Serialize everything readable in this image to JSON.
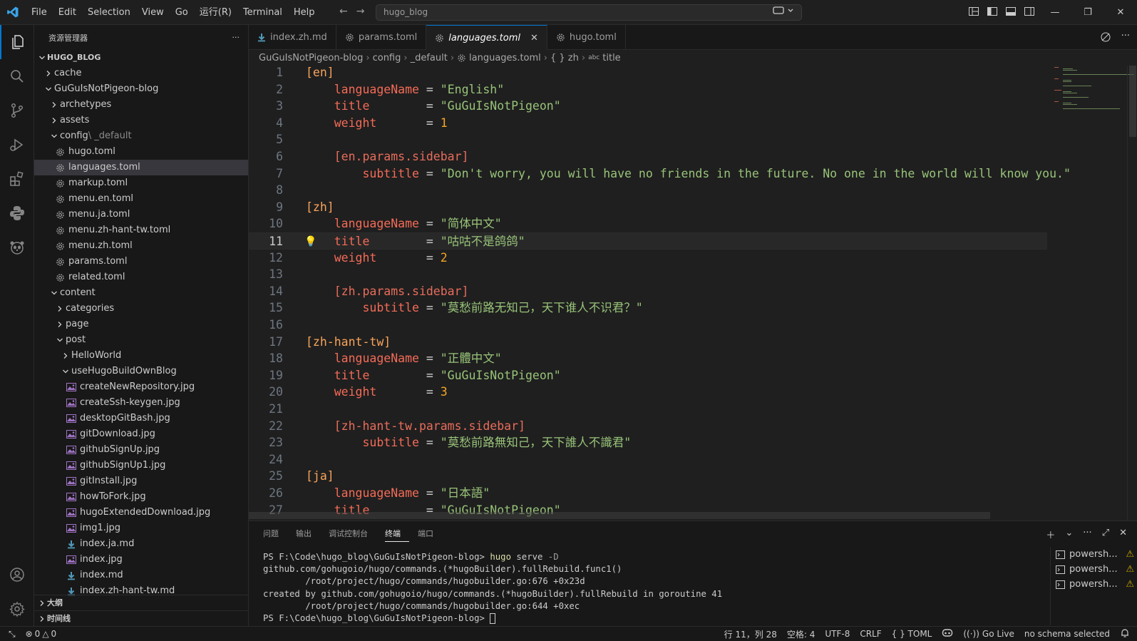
{
  "titlebar": {
    "menus": [
      "File",
      "Edit",
      "Selection",
      "View",
      "Go",
      "运行(R)",
      "Terminal",
      "Help"
    ],
    "search_text": "hugo_blog"
  },
  "explorer": {
    "title": "资源管理器",
    "more": "···",
    "root": "HUGO_BLOG",
    "tree": [
      {
        "label": "cache",
        "depth": 0,
        "kind": "folder",
        "open": false
      },
      {
        "label": "GuGuIsNotPigeon-blog",
        "depth": 0,
        "kind": "folder",
        "open": true
      },
      {
        "label": "archetypes",
        "depth": 1,
        "kind": "folder",
        "open": false
      },
      {
        "label": "assets",
        "depth": 1,
        "kind": "folder",
        "open": false
      },
      {
        "label": "config",
        "sub": "\\ _default",
        "depth": 1,
        "kind": "folder",
        "open": true
      },
      {
        "label": "hugo.toml",
        "depth": 2,
        "kind": "gear"
      },
      {
        "label": "languages.toml",
        "depth": 2,
        "kind": "gear",
        "selected": true
      },
      {
        "label": "markup.toml",
        "depth": 2,
        "kind": "gear"
      },
      {
        "label": "menu.en.toml",
        "depth": 2,
        "kind": "gear"
      },
      {
        "label": "menu.ja.toml",
        "depth": 2,
        "kind": "gear"
      },
      {
        "label": "menu.zh-hant-tw.toml",
        "depth": 2,
        "kind": "gear"
      },
      {
        "label": "menu.zh.toml",
        "depth": 2,
        "kind": "gear"
      },
      {
        "label": "params.toml",
        "depth": 2,
        "kind": "gear"
      },
      {
        "label": "related.toml",
        "depth": 2,
        "kind": "gear"
      },
      {
        "label": "content",
        "depth": 1,
        "kind": "folder",
        "open": true
      },
      {
        "label": "categories",
        "depth": 2,
        "kind": "folder",
        "open": false
      },
      {
        "label": "page",
        "depth": 2,
        "kind": "folder",
        "open": false
      },
      {
        "label": "post",
        "depth": 2,
        "kind": "folder",
        "open": true
      },
      {
        "label": "HelloWorld",
        "depth": 3,
        "kind": "folder",
        "open": false
      },
      {
        "label": "useHugoBuildOwnBlog",
        "depth": 3,
        "kind": "folder",
        "open": true
      },
      {
        "label": "createNewRepository.jpg",
        "depth": 4,
        "kind": "image"
      },
      {
        "label": "createSsh-keygen.jpg",
        "depth": 4,
        "kind": "image"
      },
      {
        "label": "desktopGitBash.jpg",
        "depth": 4,
        "kind": "image"
      },
      {
        "label": "gitDownload.jpg",
        "depth": 4,
        "kind": "image"
      },
      {
        "label": "githubSignUp.jpg",
        "depth": 4,
        "kind": "image"
      },
      {
        "label": "githubSignUp1.jpg",
        "depth": 4,
        "kind": "image"
      },
      {
        "label": "gitInstall.jpg",
        "depth": 4,
        "kind": "image"
      },
      {
        "label": "howToFork.jpg",
        "depth": 4,
        "kind": "image"
      },
      {
        "label": "hugoExtendedDownload.jpg",
        "depth": 4,
        "kind": "image"
      },
      {
        "label": "img1.jpg",
        "depth": 4,
        "kind": "image"
      },
      {
        "label": "index.ja.md",
        "depth": 4,
        "kind": "markdown"
      },
      {
        "label": "index.jpg",
        "depth": 4,
        "kind": "image"
      },
      {
        "label": "index.md",
        "depth": 4,
        "kind": "markdown"
      },
      {
        "label": "index.zh-hant-tw.md",
        "depth": 4,
        "kind": "markdown"
      }
    ],
    "outline": "大纲",
    "timeline": "时间线"
  },
  "tabs": [
    {
      "label": "index.zh.md",
      "icon": "markdown-icon",
      "active": false
    },
    {
      "label": "params.toml",
      "icon": "gear-icon",
      "active": false
    },
    {
      "label": "languages.toml",
      "icon": "gear-icon",
      "active": true
    },
    {
      "label": "hugo.toml",
      "icon": "gear-icon",
      "active": false
    }
  ],
  "breadcrumb": {
    "repo": "GuGuIsNotPigeon-blog",
    "config": "config",
    "default": "_default",
    "file": "languages.toml",
    "obj": "{ } zh",
    "abc": "abc",
    "field": "title"
  },
  "editor": {
    "current_line": 11,
    "lines": [
      [
        [
          "[en]",
          "br"
        ]
      ],
      [
        [
          "    languageName",
          "key"
        ],
        [
          " = ",
          "eq"
        ],
        [
          "\"English\"",
          "str"
        ]
      ],
      [
        [
          "    title",
          "key"
        ],
        [
          "        = ",
          "eq"
        ],
        [
          "\"GuGuIsNotPigeon\"",
          "str"
        ]
      ],
      [
        [
          "    weight",
          "key"
        ],
        [
          "       = ",
          "eq"
        ],
        [
          "1",
          "num"
        ]
      ],
      [],
      [
        [
          "    [en.params.sidebar]",
          "sec"
        ]
      ],
      [
        [
          "        subtitle",
          "key"
        ],
        [
          " = ",
          "eq"
        ],
        [
          "\"Don't worry, you will have no friends in the future. No one in the world will know you.\"",
          "str"
        ]
      ],
      [],
      [
        [
          "[zh]",
          "br"
        ]
      ],
      [
        [
          "    languageName",
          "key"
        ],
        [
          " = ",
          "eq"
        ],
        [
          "\"简体中文\"",
          "str"
        ]
      ],
      [
        [
          "    title",
          "key"
        ],
        [
          "        = ",
          "eq"
        ],
        [
          "\"咕咕不是鸽鸽\"",
          "str"
        ]
      ],
      [
        [
          "    weight",
          "key"
        ],
        [
          "       = ",
          "eq"
        ],
        [
          "2",
          "num"
        ]
      ],
      [],
      [
        [
          "    [zh.params.sidebar]",
          "sec"
        ]
      ],
      [
        [
          "        subtitle",
          "key"
        ],
        [
          " = ",
          "eq"
        ],
        [
          "\"莫愁前路无知己，天下谁人不识君？\"",
          "str"
        ]
      ],
      [],
      [
        [
          "[zh-hant-tw]",
          "br"
        ]
      ],
      [
        [
          "    languageName",
          "key"
        ],
        [
          " = ",
          "eq"
        ],
        [
          "\"正體中文\"",
          "str"
        ]
      ],
      [
        [
          "    title",
          "key"
        ],
        [
          "        = ",
          "eq"
        ],
        [
          "\"GuGuIsNotPigeon\"",
          "str"
        ]
      ],
      [
        [
          "    weight",
          "key"
        ],
        [
          "       = ",
          "eq"
        ],
        [
          "3",
          "num"
        ]
      ],
      [],
      [
        [
          "    [zh-hant-tw.params.sidebar]",
          "sec"
        ]
      ],
      [
        [
          "        subtitle",
          "key"
        ],
        [
          " = ",
          "eq"
        ],
        [
          "\"莫愁前路無知己，天下誰人不識君\"",
          "str"
        ]
      ],
      [],
      [
        [
          "[ja]",
          "br"
        ]
      ],
      [
        [
          "    languageName",
          "key"
        ],
        [
          " = ",
          "eq"
        ],
        [
          "\"日本語\"",
          "str"
        ]
      ],
      [
        [
          "    title",
          "key"
        ],
        [
          "        = ",
          "eq"
        ],
        [
          "\"GuGuIsNotPigeon\"",
          "str"
        ]
      ]
    ]
  },
  "panel": {
    "tabs": [
      "问题",
      "输出",
      "调试控制台",
      "终端",
      "端口"
    ],
    "active_tab": "终端",
    "terminal_lines": [
      {
        "parts": [
          [
            "PS F:\\Code\\hugo_blog\\GuGuIsNotPigeon-blog> ",
            "plain"
          ],
          [
            "hugo",
            "hugo"
          ],
          [
            " serve",
            "plain"
          ],
          [
            " -D",
            "flag"
          ]
        ]
      },
      {
        "parts": [
          [
            "github.com/gohugoio/hugo/commands.(*hugoBuilder).fullRebuild.func1()",
            "plain"
          ]
        ]
      },
      {
        "parts": [
          [
            "        /root/project/hugo/commands/hugobuilder.go:676 +0x23d",
            "plain"
          ]
        ]
      },
      {
        "parts": [
          [
            "created by github.com/gohugoio/hugo/commands.(*hugoBuilder).fullRebuild in goroutine 41",
            "plain"
          ]
        ]
      },
      {
        "parts": [
          [
            "        /root/project/hugo/commands/hugobuilder.go:644 +0xec",
            "plain"
          ]
        ]
      },
      {
        "parts": [
          [
            "PS F:\\Code\\hugo_blog\\GuGuIsNotPigeon-blog> ",
            "plain"
          ]
        ],
        "cursor": true
      }
    ],
    "terminals": [
      "powersh...",
      "powersh...",
      "powersh..."
    ]
  },
  "statusbar": {
    "errors": "0",
    "warnings": "0",
    "position": "行 11，列 28",
    "spaces": "空格: 4",
    "encoding": "UTF-8",
    "eol": "CRLF",
    "language": "{ } TOML",
    "golive": "Go Live",
    "schema": "no schema selected"
  }
}
